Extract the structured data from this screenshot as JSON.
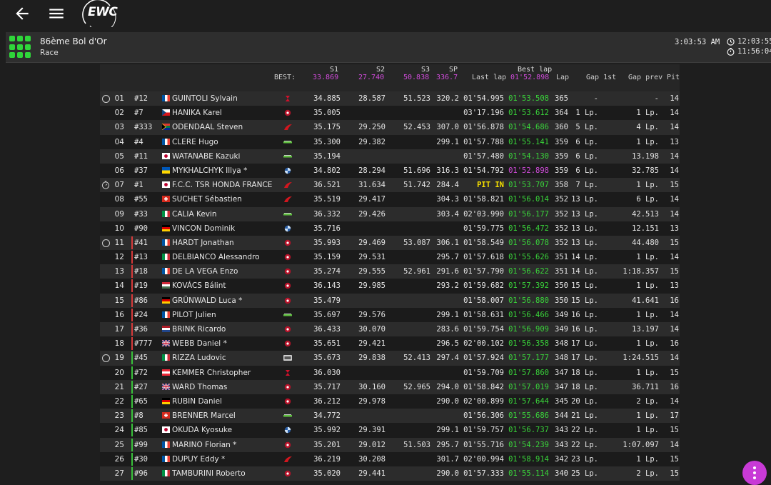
{
  "app": {
    "logo_text": "EWC"
  },
  "event": {
    "title": "86ème Bol d'Or",
    "session": "Race"
  },
  "clocks": {
    "main": "3:03:53 AM",
    "time_a": "12:03:55",
    "time_b": "11:56:04"
  },
  "best": {
    "label": "BEST:",
    "s1": "33.869",
    "s2": "27.740",
    "s3": "50.838",
    "sp": "336.7",
    "best_lap": "01'52.898"
  },
  "columns": {
    "s1": "S1",
    "s2": "S2",
    "s3": "S3",
    "sp": "SP",
    "best_lap": "Best lap",
    "last_lap": "Last lap",
    "lap": "Lap",
    "gap1": "Gap 1st",
    "gapp": "Gap prev",
    "pit": "Pit"
  },
  "colors": {
    "purple": "#cf4bd9",
    "green": "#39d43a",
    "yellow": "#f6e000",
    "accent": "#c83ad6"
  },
  "rows": [
    {
      "pos": "01",
      "num": "#12",
      "flag": "fr",
      "name": "GUINTOLI Sylvain",
      "brand": "suzuki",
      "s1": "34.885",
      "s2": "28.587",
      "s3": "51.523",
      "sp": "320.2",
      "last": "01'54.995",
      "best": "01'53.508",
      "lap": "365",
      "gap1": "-",
      "gapp": "-",
      "pit": "14",
      "marker": "circle",
      "bar": "none"
    },
    {
      "pos": "02",
      "num": "#7",
      "flag": "cz",
      "name": "HANIKA Karel",
      "brand": "yamaha",
      "s1": "35.005",
      "s2": "",
      "s3": "",
      "sp": "",
      "last": "03'17.196",
      "best": "01'53.612",
      "lap": "364",
      "gap1": "1 Lp.",
      "gapp": "1 Lp.",
      "pit": "14",
      "marker": "",
      "bar": "none"
    },
    {
      "pos": "03",
      "num": "#333",
      "flag": "za",
      "name": "ODENDAAL Steven",
      "brand": "honda",
      "s1": "35.175",
      "s2": "29.250",
      "s3": "52.453",
      "sp": "307.0",
      "last": "01'56.878",
      "best": "01'54.686",
      "lap": "360",
      "gap1": "5 Lp.",
      "gapp": "4 Lp.",
      "pit": "14",
      "marker": "",
      "bar": "none"
    },
    {
      "pos": "04",
      "num": "#4",
      "flag": "fr",
      "name": "CLERE Hugo",
      "brand": "kawasaki",
      "s1": "35.300",
      "s2": "29.382",
      "s3": "",
      "sp": "299.1",
      "last": "01'57.788",
      "best": "01'55.141",
      "lap": "359",
      "gap1": "6 Lp.",
      "gapp": "1 Lp.",
      "pit": "13",
      "marker": "",
      "bar": "none"
    },
    {
      "pos": "05",
      "num": "#11",
      "flag": "jp",
      "name": "WATANABE Kazuki",
      "brand": "kawasaki",
      "s1": "35.194",
      "s2": "",
      "s3": "",
      "sp": "",
      "last": "01'57.480",
      "best": "01'54.130",
      "lap": "359",
      "gap1": "6 Lp.",
      "gapp": "13.198",
      "pit": "14",
      "marker": "",
      "bar": "none"
    },
    {
      "pos": "06",
      "num": "#37",
      "flag": "ua",
      "name": "MYKHALCHYK Illya *",
      "brand": "bmw",
      "s1": "34.802",
      "s2": "28.294",
      "s3": "51.696",
      "sp": "316.3",
      "last": "01'54.792",
      "best": "01'52.898",
      "lap": "359",
      "gap1": "6 Lp.",
      "gapp": "32.785",
      "pit": "14",
      "marker": "",
      "bar": "none",
      "best_color": "purple"
    },
    {
      "pos": "07",
      "num": "#1",
      "flag": "jp",
      "name": "F.C.C. TSR HONDA FRANCE",
      "brand": "honda",
      "s1": "36.521",
      "s2": "31.634",
      "s3": "51.742",
      "sp": "284.4",
      "last": "PIT IN",
      "best": "01'53.707",
      "lap": "358",
      "gap1": "7 Lp.",
      "gapp": "1 Lp.",
      "pit": "15",
      "marker": "stopwatch",
      "bar": "none",
      "last_color": "yellow"
    },
    {
      "pos": "08",
      "num": "#55",
      "flag": "ch",
      "name": "SUCHET Sébastien",
      "brand": "honda",
      "s1": "35.519",
      "s2": "29.417",
      "s3": "",
      "sp": "304.3",
      "last": "01'58.821",
      "best": "01'56.014",
      "lap": "352",
      "gap1": "13 Lp.",
      "gapp": "6 Lp.",
      "pit": "14",
      "marker": "",
      "bar": "none"
    },
    {
      "pos": "09",
      "num": "#33",
      "flag": "it",
      "name": "CALIA Kevin",
      "brand": "kawasaki",
      "s1": "36.332",
      "s2": "29.426",
      "s3": "",
      "sp": "303.4",
      "last": "02'03.990",
      "best": "01'56.177",
      "lap": "352",
      "gap1": "13 Lp.",
      "gapp": "42.513",
      "pit": "14",
      "marker": "",
      "bar": "none"
    },
    {
      "pos": "10",
      "num": "#90",
      "flag": "de",
      "name": "VINCON Dominik",
      "brand": "bmw",
      "s1": "35.716",
      "s2": "",
      "s3": "",
      "sp": "",
      "last": "01'59.775",
      "best": "01'56.472",
      "lap": "352",
      "gap1": "13 Lp.",
      "gapp": "12.151",
      "pit": "13",
      "marker": "",
      "bar": "none"
    },
    {
      "pos": "11",
      "num": "#41",
      "flag": "fr",
      "name": "HARDT Jonathan",
      "brand": "yamaha",
      "s1": "35.993",
      "s2": "29.469",
      "s3": "53.087",
      "sp": "306.1",
      "last": "01'58.549",
      "best": "01'56.078",
      "lap": "352",
      "gap1": "13 Lp.",
      "gapp": "44.480",
      "pit": "15",
      "marker": "circle",
      "bar": "red"
    },
    {
      "pos": "12",
      "num": "#13",
      "flag": "it",
      "name": "DELBIANCO Alessandro",
      "brand": "yamaha",
      "s1": "35.159",
      "s2": "29.531",
      "s3": "",
      "sp": "295.7",
      "last": "01'57.618",
      "best": "01'55.626",
      "lap": "351",
      "gap1": "14 Lp.",
      "gapp": "1 Lp.",
      "pit": "14",
      "marker": "",
      "bar": "red"
    },
    {
      "pos": "13",
      "num": "#18",
      "flag": "fr",
      "name": "DE LA VEGA Enzo",
      "brand": "yamaha",
      "s1": "35.274",
      "s2": "29.555",
      "s3": "52.961",
      "sp": "291.6",
      "last": "01'57.790",
      "best": "01'56.622",
      "lap": "351",
      "gap1": "14 Lp.",
      "gapp": "1:18.357",
      "pit": "15",
      "marker": "",
      "bar": "red"
    },
    {
      "pos": "14",
      "num": "#19",
      "flag": "hu",
      "name": "KOVÁCS Bálint",
      "brand": "yamaha",
      "s1": "36.143",
      "s2": "29.985",
      "s3": "",
      "sp": "293.2",
      "last": "01'59.682",
      "best": "01'57.392",
      "lap": "350",
      "gap1": "15 Lp.",
      "gapp": "1 Lp.",
      "pit": "13",
      "marker": "",
      "bar": "red"
    },
    {
      "pos": "15",
      "num": "#86",
      "flag": "de",
      "name": "GRÜNWALD Luca *",
      "brand": "yamaha",
      "s1": "35.479",
      "s2": "",
      "s3": "",
      "sp": "",
      "last": "01'58.007",
      "best": "01'56.880",
      "lap": "350",
      "gap1": "15 Lp.",
      "gapp": "41.641",
      "pit": "16",
      "marker": "",
      "bar": "red"
    },
    {
      "pos": "16",
      "num": "#24",
      "flag": "fr",
      "name": "PILOT Julien",
      "brand": "kawasaki",
      "s1": "35.697",
      "s2": "29.576",
      "s3": "",
      "sp": "299.1",
      "last": "01'58.631",
      "best": "01'56.466",
      "lap": "349",
      "gap1": "16 Lp.",
      "gapp": "1 Lp.",
      "pit": "14",
      "marker": "",
      "bar": "red"
    },
    {
      "pos": "17",
      "num": "#36",
      "flag": "nl",
      "name": "BRINK Ricardo",
      "brand": "yamaha",
      "s1": "36.433",
      "s2": "30.070",
      "s3": "",
      "sp": "283.6",
      "last": "01'59.754",
      "best": "01'56.909",
      "lap": "349",
      "gap1": "16 Lp.",
      "gapp": "13.197",
      "pit": "14",
      "marker": "",
      "bar": "red"
    },
    {
      "pos": "18",
      "num": "#777",
      "flag": "gb",
      "name": "WEBB Daniel *",
      "brand": "yamaha",
      "s1": "35.651",
      "s2": "29.421",
      "s3": "",
      "sp": "296.5",
      "last": "02'00.102",
      "best": "01'56.358",
      "lap": "348",
      "gap1": "17 Lp.",
      "gapp": "1 Lp.",
      "pit": "16",
      "marker": "",
      "bar": "red"
    },
    {
      "pos": "19",
      "num": "#45",
      "flag": "it",
      "name": "RIZZA Ludovic",
      "brand": "other",
      "s1": "35.673",
      "s2": "29.838",
      "s3": "52.413",
      "sp": "297.4",
      "last": "01'57.924",
      "best": "01'57.177",
      "lap": "348",
      "gap1": "17 Lp.",
      "gapp": "1:24.515",
      "pit": "14",
      "marker": "circle",
      "bar": "green"
    },
    {
      "pos": "20",
      "num": "#72",
      "flag": "at",
      "name": "KEMMER Christopher",
      "brand": "suzuki",
      "s1": "36.030",
      "s2": "",
      "s3": "",
      "sp": "",
      "last": "01'59.709",
      "best": "01'57.860",
      "lap": "347",
      "gap1": "18 Lp.",
      "gapp": "1 Lp.",
      "pit": "15",
      "marker": "",
      "bar": "green"
    },
    {
      "pos": "21",
      "num": "#27",
      "flag": "gb",
      "name": "WARD Thomas",
      "brand": "yamaha",
      "s1": "35.717",
      "s2": "30.160",
      "s3": "52.965",
      "sp": "294.0",
      "last": "01'58.842",
      "best": "01'57.019",
      "lap": "347",
      "gap1": "18 Lp.",
      "gapp": "36.711",
      "pit": "16",
      "marker": "",
      "bar": "green"
    },
    {
      "pos": "22",
      "num": "#65",
      "flag": "de",
      "name": "RUBIN Daniel",
      "brand": "yamaha",
      "s1": "36.212",
      "s2": "29.978",
      "s3": "",
      "sp": "290.0",
      "last": "02'00.899",
      "best": "01'57.644",
      "lap": "345",
      "gap1": "20 Lp.",
      "gapp": "2 Lp.",
      "pit": "14",
      "marker": "",
      "bar": "green"
    },
    {
      "pos": "23",
      "num": "#8",
      "flag": "ch",
      "name": "BRENNER Marcel",
      "brand": "kawasaki",
      "s1": "34.772",
      "s2": "",
      "s3": "",
      "sp": "",
      "last": "01'56.306",
      "best": "01'55.686",
      "lap": "344",
      "gap1": "21 Lp.",
      "gapp": "1 Lp.",
      "pit": "17",
      "marker": "",
      "bar": "green"
    },
    {
      "pos": "24",
      "num": "#85",
      "flag": "jp",
      "name": "OKUDA Kyosuke",
      "brand": "bmw",
      "s1": "35.992",
      "s2": "29.391",
      "s3": "",
      "sp": "299.1",
      "last": "01'59.757",
      "best": "01'56.737",
      "lap": "343",
      "gap1": "22 Lp.",
      "gapp": "1 Lp.",
      "pit": "15",
      "marker": "",
      "bar": "green"
    },
    {
      "pos": "25",
      "num": "#99",
      "flag": "fr",
      "name": "MARINO Florian *",
      "brand": "yamaha",
      "s1": "35.201",
      "s2": "29.012",
      "s3": "51.503",
      "sp": "295.7",
      "last": "01'55.716",
      "best": "01'54.239",
      "lap": "343",
      "gap1": "22 Lp.",
      "gapp": "1:07.097",
      "pit": "14",
      "marker": "",
      "bar": "green"
    },
    {
      "pos": "26",
      "num": "#30",
      "flag": "fr",
      "name": "DUPUY Eddy *",
      "brand": "honda",
      "s1": "36.219",
      "s2": "30.208",
      "s3": "",
      "sp": "301.7",
      "last": "02'00.994",
      "best": "01'58.914",
      "lap": "342",
      "gap1": "23 Lp.",
      "gapp": "1 Lp.",
      "pit": "15",
      "marker": "",
      "bar": "green"
    },
    {
      "pos": "27",
      "num": "#96",
      "flag": "it",
      "name": "TAMBURINI Roberto",
      "brand": "yamaha",
      "s1": "35.020",
      "s2": "29.441",
      "s3": "",
      "sp": "290.0",
      "last": "01'57.333",
      "best": "01'55.114",
      "lap": "340",
      "gap1": "25 Lp.",
      "gapp": "2 Lp.",
      "pit": "15",
      "marker": "",
      "bar": "green"
    }
  ]
}
